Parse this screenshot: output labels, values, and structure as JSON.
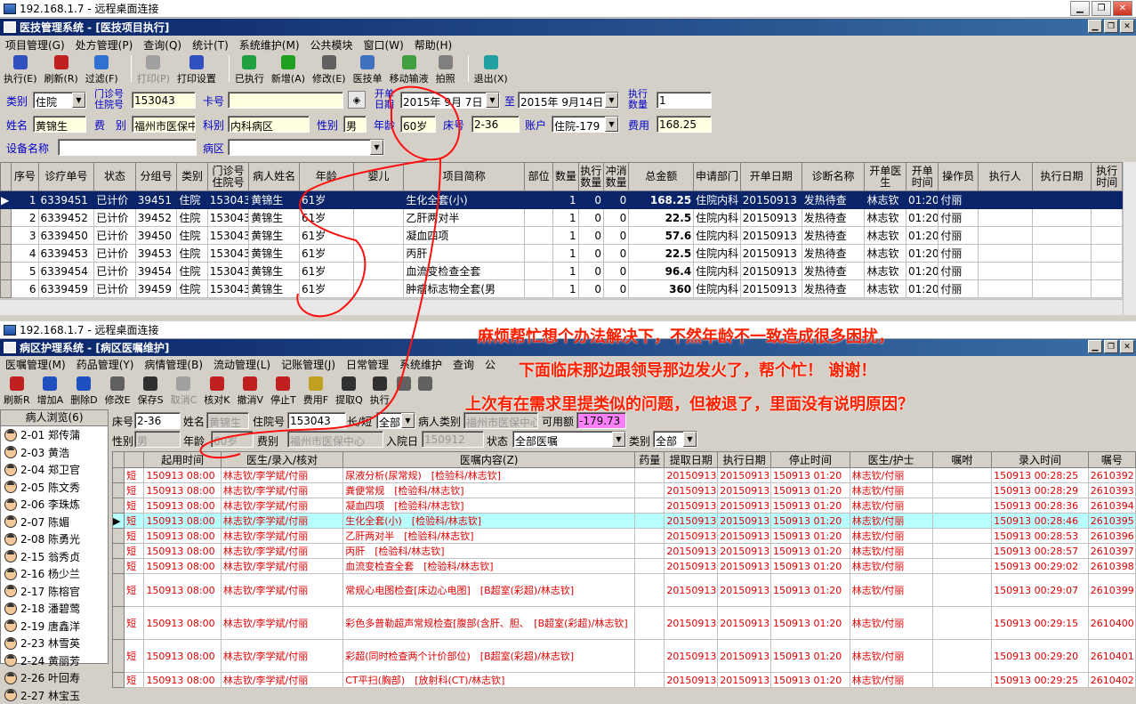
{
  "rd1": {
    "title": "192.168.1.7 - 远程桌面连接"
  },
  "app1": {
    "title": "医技管理系统 - [医技项目执行]"
  },
  "menu1": [
    "项目管理(G)",
    "处方管理(P)",
    "查询(Q)",
    "统计(T)",
    "系统维护(M)",
    "公共模块",
    "窗口(W)",
    "帮助(H)"
  ],
  "tb1": [
    {
      "label": "执行(E)",
      "icon": "gear-icon",
      "color": "#3050c0",
      "disabled": false
    },
    {
      "label": "刷新(R)",
      "icon": "refresh-icon",
      "color": "#c02020",
      "disabled": false
    },
    {
      "label": "过滤(F)",
      "icon": "filter-icon",
      "color": "#3070d0",
      "disabled": false
    },
    {
      "label": "打印(P)",
      "icon": "print-icon",
      "color": "#a0a0a0",
      "disabled": true
    },
    {
      "label": "打印设置",
      "icon": "print-setup-icon",
      "color": "#3050c0",
      "disabled": false
    },
    {
      "label": "已执行",
      "icon": "check-icon",
      "color": "#20a040",
      "disabled": false
    },
    {
      "label": "新增(A)",
      "icon": "add-icon",
      "color": "#20a020",
      "disabled": false
    },
    {
      "label": "修改(E)",
      "icon": "edit-icon",
      "color": "#606060",
      "disabled": false
    },
    {
      "label": "医技单",
      "icon": "document-icon",
      "color": "#4070c0",
      "disabled": false
    },
    {
      "label": "移动输液",
      "icon": "infusion-icon",
      "color": "#40a040",
      "disabled": false
    },
    {
      "label": "拍照",
      "icon": "camera-icon",
      "color": "#808080",
      "disabled": false
    },
    {
      "label": "退出(X)",
      "icon": "exit-icon",
      "color": "#20a0a0",
      "disabled": false
    }
  ],
  "form1": {
    "category_label": "类别",
    "category_value": "住院",
    "clinic_label_1": "门诊号",
    "clinic_label_2": "住院号",
    "clinic_value": "153043",
    "card_label": "卡号",
    "card_value": "",
    "open_date_label_1": "开单",
    "open_date_label_2": "日期",
    "date_from": "2015年 9月 7日",
    "date_to_label": "至",
    "date_to": "2015年 9月14日",
    "exec_label_1": "执行",
    "exec_label_2": "数量",
    "exec_value": "1",
    "name_label": "姓名",
    "name_value": "黄锦生",
    "fee_label": "费　别",
    "fee_value": "福州市医保中心",
    "dept_label": "科别",
    "dept_value": "内科病区",
    "sex_label": "性别",
    "sex_value": "男",
    "age_label": "年龄",
    "age_value": "60岁",
    "bed_label": "床号",
    "bed_value": "2-36",
    "account_label": "账户",
    "account_value": "住院-179",
    "cost_label": "费用",
    "cost_value": "168.25",
    "device_label": "设备名称",
    "device_value": "",
    "ward_label": "病区",
    "ward_value": ""
  },
  "grid1": {
    "headers": [
      "序号",
      "诊疗单号",
      "状态",
      "分组号",
      "类别",
      "门诊号住院号",
      "病人姓名",
      "年龄",
      "婴儿",
      "项目简称",
      "部位",
      "数量",
      "执行数量",
      "冲消数量",
      "总金额",
      "申请部门",
      "开单日期",
      "诊断名称",
      "开单医生",
      "开单时间",
      "操作员",
      "执行人",
      "执行日期",
      "执行时间"
    ],
    "rows": [
      [
        "1",
        "6339451",
        "已计价",
        "39451",
        "住院",
        "153043",
        "黄锦生",
        "61岁",
        "",
        "生化全套(小)",
        "",
        "1",
        "0",
        "0",
        "168.25",
        "住院内科",
        "20150913",
        "发热待查",
        "林志钦",
        "01:20",
        "付丽",
        "",
        "",
        ""
      ],
      [
        "2",
        "6339452",
        "已计价",
        "39452",
        "住院",
        "153043",
        "黄锦生",
        "61岁",
        "",
        "乙肝两对半",
        "",
        "1",
        "0",
        "0",
        "22.5",
        "住院内科",
        "20150913",
        "发热待查",
        "林志钦",
        "01:20",
        "付丽",
        "",
        "",
        ""
      ],
      [
        "3",
        "6339450",
        "已计价",
        "39450",
        "住院",
        "153043",
        "黄锦生",
        "61岁",
        "",
        "凝血四项",
        "",
        "1",
        "0",
        "0",
        "57.6",
        "住院内科",
        "20150913",
        "发热待查",
        "林志钦",
        "01:20",
        "付丽",
        "",
        "",
        ""
      ],
      [
        "4",
        "6339453",
        "已计价",
        "39453",
        "住院",
        "153043",
        "黄锦生",
        "61岁",
        "",
        "丙肝",
        "",
        "1",
        "0",
        "0",
        "22.5",
        "住院内科",
        "20150913",
        "发热待查",
        "林志钦",
        "01:20",
        "付丽",
        "",
        "",
        ""
      ],
      [
        "5",
        "6339454",
        "已计价",
        "39454",
        "住院",
        "153043",
        "黄锦生",
        "61岁",
        "",
        "血流变检查全套",
        "",
        "1",
        "0",
        "0",
        "96.4",
        "住院内科",
        "20150913",
        "发热待查",
        "林志钦",
        "01:20",
        "付丽",
        "",
        "",
        ""
      ],
      [
        "6",
        "6339459",
        "已计价",
        "39459",
        "住院",
        "153043",
        "黄锦生",
        "61岁",
        "",
        "肿瘤标志物全套(男",
        "",
        "1",
        "0",
        "0",
        "360",
        "住院内科",
        "20150913",
        "发热待查",
        "林志钦",
        "01:20",
        "付丽",
        "",
        "",
        ""
      ]
    ]
  },
  "rd2": {
    "title": "192.168.1.7 - 远程桌面连接"
  },
  "app2": {
    "title": "病区护理系统 - [病区医嘱维护]"
  },
  "menu2": [
    "医嘱管理(M)",
    "药品管理(Y)",
    "病情管理(B)",
    "流动管理(L)",
    "记账管理(J)",
    "日常管理",
    "系统维护",
    "查询",
    "公"
  ],
  "tb2": [
    {
      "label": "刷新R",
      "icon": "refresh-icon",
      "color": "#c02020",
      "disabled": false
    },
    {
      "label": "增加A",
      "icon": "add-icon",
      "color": "#2050c0",
      "disabled": false
    },
    {
      "label": "删除D",
      "icon": "delete-icon",
      "color": "#2050c0",
      "disabled": false
    },
    {
      "label": "修改E",
      "icon": "edit-icon",
      "color": "#606060",
      "disabled": false
    },
    {
      "label": "保存S",
      "icon": "save-icon",
      "color": "#303030",
      "disabled": false
    },
    {
      "label": "取消C",
      "icon": "cancel-icon",
      "color": "#a0a0a0",
      "disabled": true
    },
    {
      "label": "核对K",
      "icon": "check-icon",
      "color": "#c02020",
      "disabled": false
    },
    {
      "label": "撤消V",
      "icon": "undo-icon",
      "color": "#c02020",
      "disabled": false
    },
    {
      "label": "停止T",
      "icon": "stop-icon",
      "color": "#c02020",
      "disabled": false
    },
    {
      "label": "费用F",
      "icon": "money-icon",
      "color": "#c0a020",
      "disabled": false
    },
    {
      "label": "提取Q",
      "icon": "extract-icon",
      "color": "#303030",
      "disabled": false
    },
    {
      "label": "执行",
      "icon": "car-icon",
      "color": "#303030",
      "disabled": false
    },
    {
      "label": "",
      "icon": "hammer-icon",
      "color": "#606060",
      "disabled": false
    },
    {
      "label": "",
      "icon": "print-icon",
      "color": "#606060",
      "disabled": false
    }
  ],
  "form2": {
    "bed_label": "床号",
    "bed_value": "2-36",
    "name_label": "姓名",
    "name_value": "黄锦生",
    "inpatient_label": "住院号",
    "inpatient_value": "153043",
    "longshort_label": "长/短",
    "longshort_value": "全部",
    "ptype_label": "病人类别",
    "ptype_value": "福州市医保中心",
    "avail_label": "可用额",
    "avail_value": "-179.73",
    "sex_label": "性别",
    "sex_value": "男",
    "age_label": "年龄",
    "age_value": "60岁",
    "fee_label": "费别",
    "fee_value": "福州市医保中心",
    "admit_label": "入院日",
    "admit_value": "150912",
    "status_label": "状态",
    "status_value": "全部医嘱",
    "cat_label": "类别",
    "cat_value": "全部"
  },
  "patients": {
    "header": "病人浏览(6)",
    "items": [
      "2-01 郑传蒲",
      "2-03 黄浩",
      "2-04 郑卫官",
      "2-05 陈文秀",
      "2-06 李珠炼",
      "2-07 陈媚",
      "2-08 陈勇光",
      "2-15 翁秀贞",
      "2-16 杨少兰",
      "2-17 陈榕官",
      "2-18 潘碧莺",
      "2-19 唐鑫洋",
      "2-23 林雪英",
      "2-24 黄丽芳",
      "2-26 叶回寿",
      "2-27 林宝玉"
    ]
  },
  "grid2": {
    "headers": [
      "",
      "起用时间",
      "医生/录入/核对",
      "医嘱内容(Z)",
      "药量",
      "提取日期",
      "执行日期",
      "停止时间",
      "医生/护士",
      "嘱咐",
      "录入时间",
      "嘱号"
    ],
    "rows": [
      [
        "短",
        "150913 08:00",
        "林志钦/李学斌/付丽",
        "尿液分析(尿常规)　[检验科/林志钦]",
        "",
        "20150913",
        "20150913",
        "150913 01:20",
        "林志钦/付丽",
        "",
        "150913 00:28:25",
        "2610392"
      ],
      [
        "短",
        "150913 08:00",
        "林志钦/李学斌/付丽",
        "粪便常规　[检验科/林志钦]",
        "",
        "20150913",
        "20150913",
        "150913 01:20",
        "林志钦/付丽",
        "",
        "150913 00:28:29",
        "2610393"
      ],
      [
        "短",
        "150913 08:00",
        "林志钦/李学斌/付丽",
        "凝血四项　[检验科/林志钦]",
        "",
        "20150913",
        "20150913",
        "150913 01:20",
        "林志钦/付丽",
        "",
        "150913 00:28:36",
        "2610394"
      ],
      [
        "短",
        "150913 08:00",
        "林志钦/李学斌/付丽",
        "生化全套(小)　[检验科/林志钦]",
        "",
        "20150913",
        "20150913",
        "150913 01:20",
        "林志钦/付丽",
        "",
        "150913 00:28:46",
        "2610395"
      ],
      [
        "短",
        "150913 08:00",
        "林志钦/李学斌/付丽",
        "乙肝两对半　[检验科/林志钦]",
        "",
        "20150913",
        "20150913",
        "150913 01:20",
        "林志钦/付丽",
        "",
        "150913 00:28:53",
        "2610396"
      ],
      [
        "短",
        "150913 08:00",
        "林志钦/李学斌/付丽",
        "丙肝　[检验科/林志钦]",
        "",
        "20150913",
        "20150913",
        "150913 01:20",
        "林志钦/付丽",
        "",
        "150913 00:28:57",
        "2610397"
      ],
      [
        "短",
        "150913 08:00",
        "林志钦/李学斌/付丽",
        "血流变检查全套　[检验科/林志钦]",
        "",
        "20150913",
        "20150913",
        "150913 01:20",
        "林志钦/付丽",
        "",
        "150913 00:29:02",
        "2610398"
      ],
      [
        "短",
        "150913 08:00",
        "林志钦/李学斌/付丽",
        "常规心电图检查[床边心电图]　[B超室(彩超)/林志钦]",
        "",
        "20150913",
        "20150913",
        "150913 01:20",
        "林志钦/付丽",
        "",
        "150913 00:29:07",
        "2610399"
      ],
      [
        "短",
        "150913 08:00",
        "林志钦/李学斌/付丽",
        "彩色多普勒超声常规检查[腹部(含肝、胆、　[B超室(彩超)/林志钦]",
        "",
        "20150913",
        "20150913",
        "150913 01:20",
        "林志钦/付丽",
        "",
        "150913 00:29:15",
        "2610400"
      ],
      [
        "短",
        "150913 08:00",
        "林志钦/李学斌/付丽",
        "彩超(同时检查两个计价部位)　[B超室(彩超)/林志钦]",
        "",
        "20150913",
        "20150913",
        "150913 01:20",
        "林志钦/付丽",
        "",
        "150913 00:29:20",
        "2610401"
      ],
      [
        "短",
        "150913 08:00",
        "林志钦/李学斌/付丽",
        "CT平扫(胸部)　[放射科(CT)/林志钦]",
        "",
        "20150913",
        "20150913",
        "150913 01:20",
        "林志钦/付丽",
        "",
        "150913 00:29:25",
        "2610402"
      ]
    ]
  },
  "annotations": [
    "麻烦帮忙想个办法解决下，不然年龄不一致造成很多困扰，",
    "下面临床那边跟领导那边发火了，帮个忙！ 谢谢！",
    "上次有在需求里提类似的问题，但被退了，里面没有说明原因？"
  ]
}
